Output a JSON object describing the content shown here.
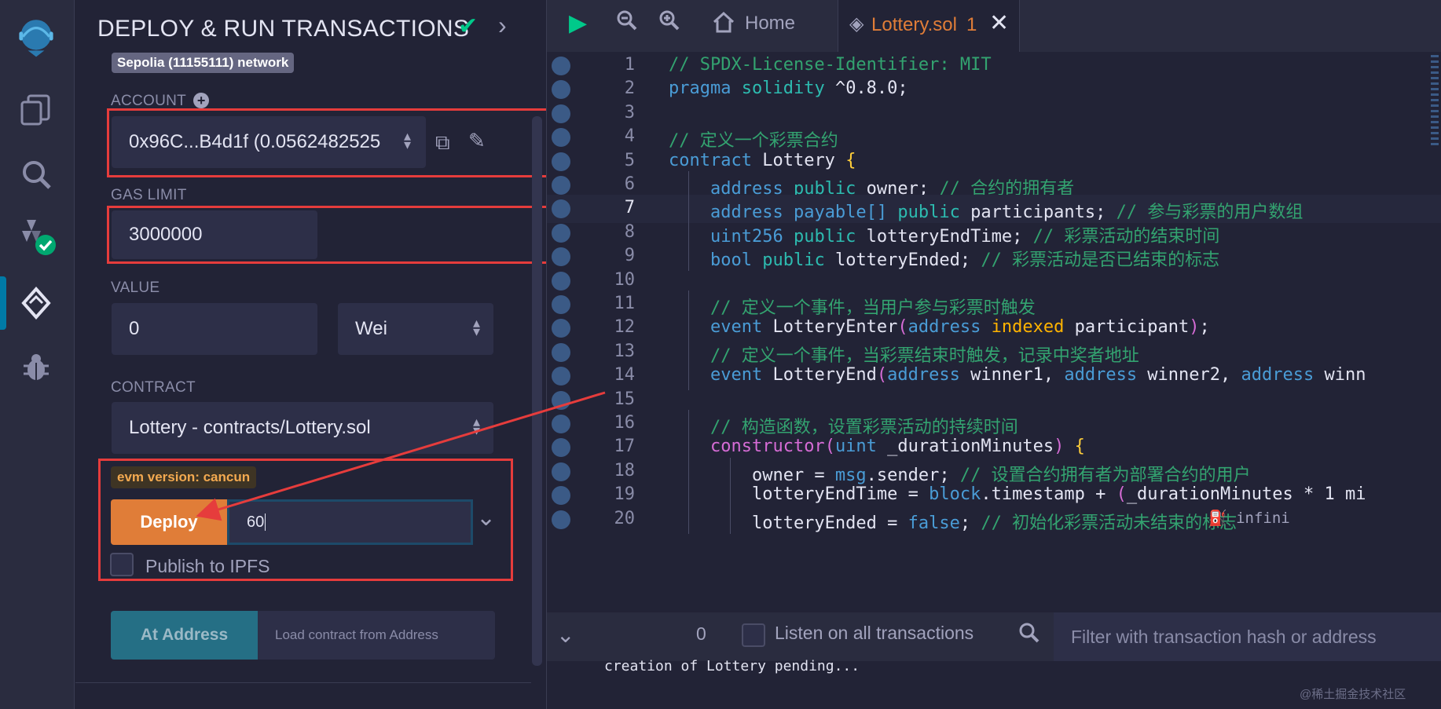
{
  "iconbar": {
    "icons": [
      "remix-logo-icon",
      "files-icon",
      "search-icon",
      "solidity-compiler-icon",
      "deploy-run-icon",
      "debugger-icon"
    ]
  },
  "panel": {
    "title": "DEPLOY & RUN TRANSACTIONS",
    "network_badge": "Sepolia (11155111) network",
    "account_label": "ACCOUNT",
    "account_value": "0x96C...B4d1f (0.0562482525",
    "gas_label": "GAS LIMIT",
    "gas_value": "3000000",
    "value_label": "VALUE",
    "value_amount": "0",
    "value_unit": "Wei",
    "contract_label": "CONTRACT",
    "contract_value": "Lottery - contracts/Lottery.sol",
    "evm_badge": "evm version: cancun",
    "deploy_label": "Deploy",
    "deploy_arg": "60",
    "ipfs_label": "Publish to IPFS",
    "at_address_label": "At Address",
    "load_placeholder": "Load contract from Address"
  },
  "editor": {
    "tabs": {
      "home": "Home",
      "file": "Lottery.sol",
      "file_issues": "1"
    },
    "code_lines": [
      {
        "n": "1",
        "text": "// SPDX-License-Identifier: MIT"
      },
      {
        "n": "2",
        "text": "pragma solidity ^0.8.0;"
      },
      {
        "n": "3",
        "text": ""
      },
      {
        "n": "4",
        "text": "// 定义一个彩票合约"
      },
      {
        "n": "5",
        "text": "contract Lottery {"
      },
      {
        "n": "6",
        "text": "    address public owner; // 合约的拥有者"
      },
      {
        "n": "7",
        "text": "    address payable[] public participants; // 参与彩票的用户数组"
      },
      {
        "n": "8",
        "text": "    uint256 public lotteryEndTime; // 彩票活动的结束时间"
      },
      {
        "n": "9",
        "text": "    bool public lotteryEnded; // 彩票活动是否已结束的标志"
      },
      {
        "n": "10",
        "text": ""
      },
      {
        "n": "11",
        "text": "    // 定义一个事件，当用户参与彩票时触发"
      },
      {
        "n": "12",
        "text": "    event LotteryEnter(address indexed participant);"
      },
      {
        "n": "13",
        "text": "    // 定义一个事件，当彩票结束时触发，记录中奖者地址"
      },
      {
        "n": "14",
        "text": "    event LotteryEnd(address winner1, address winner2, address winn"
      },
      {
        "n": "15",
        "text": ""
      },
      {
        "n": "16",
        "text": "    // 构造函数，设置彩票活动的持续时间"
      },
      {
        "n": "17",
        "text": "    constructor(uint _durationMinutes) {"
      },
      {
        "n": "18",
        "text": "        owner = msg.sender; // 设置合约拥有者为部署合约的用户"
      },
      {
        "n": "19",
        "text": "        lotteryEndTime = block.timestamp + (_durationMinutes * 1 mi"
      },
      {
        "n": "20",
        "text": "        lotteryEnded = false; // 初始化彩票活动未结束的标志"
      }
    ],
    "gas_hint": "infini"
  },
  "terminal": {
    "count": "0",
    "listen_label": "Listen on all transactions",
    "filter_placeholder": "Filter with transaction hash or address",
    "output": "creation of Lottery pending..."
  },
  "watermark": "@稀土掘金技术社区",
  "colors": {
    "background": "#222336",
    "accent_orange": "#e07d38",
    "annotation_red": "#e63c3c",
    "success_green": "#00c98a"
  }
}
